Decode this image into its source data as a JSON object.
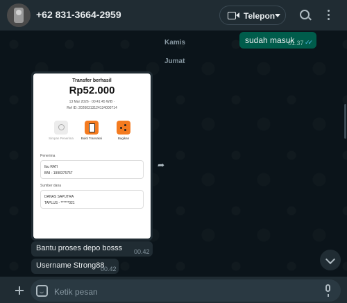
{
  "header": {
    "contact_name": "+62 831-3664-2959",
    "call_label": "Telepon",
    "icons": [
      "avatar",
      "video-camera-icon",
      "chevron-down-icon",
      "search-icon",
      "menu-icon"
    ]
  },
  "messages": {
    "outgoing": {
      "text": "sudah masuk",
      "time": "01.37",
      "status": "read"
    },
    "day_labels": [
      "Kamis",
      "Jumat"
    ],
    "receipt": {
      "title": "Transfer berhasil",
      "amount": "Rp52.000",
      "date": "13 Mar 2026 · 00:41:45 WIB ·",
      "ref": "Ref ID: 20260313124134000714",
      "actions": [
        "Simpan Penerima",
        "Bukti Transaksi",
        "Bagikan"
      ],
      "recipient_label": "Penerima",
      "recipient_name": "Ibu RATI",
      "recipient_account": "BNI - 1990375757",
      "source_label": "Sumber dana",
      "source_name": "DANAS SAPUTRA",
      "source_account": "TAPLUS - ******021"
    },
    "incoming": [
      {
        "text": "Bantu proses depo bosss",
        "time": "00.42"
      },
      {
        "text": "Username Strong88",
        "time": "00.42"
      }
    ]
  },
  "composer": {
    "placeholder": "Ketik pesan"
  },
  "colors": {
    "background": "#0b141a",
    "header": "#202c33",
    "outgoing_bubble": "#005c4b",
    "incoming_bubble": "#202c33",
    "accent_orange": "#f47b20",
    "read_ticks": "#53bdeb"
  }
}
